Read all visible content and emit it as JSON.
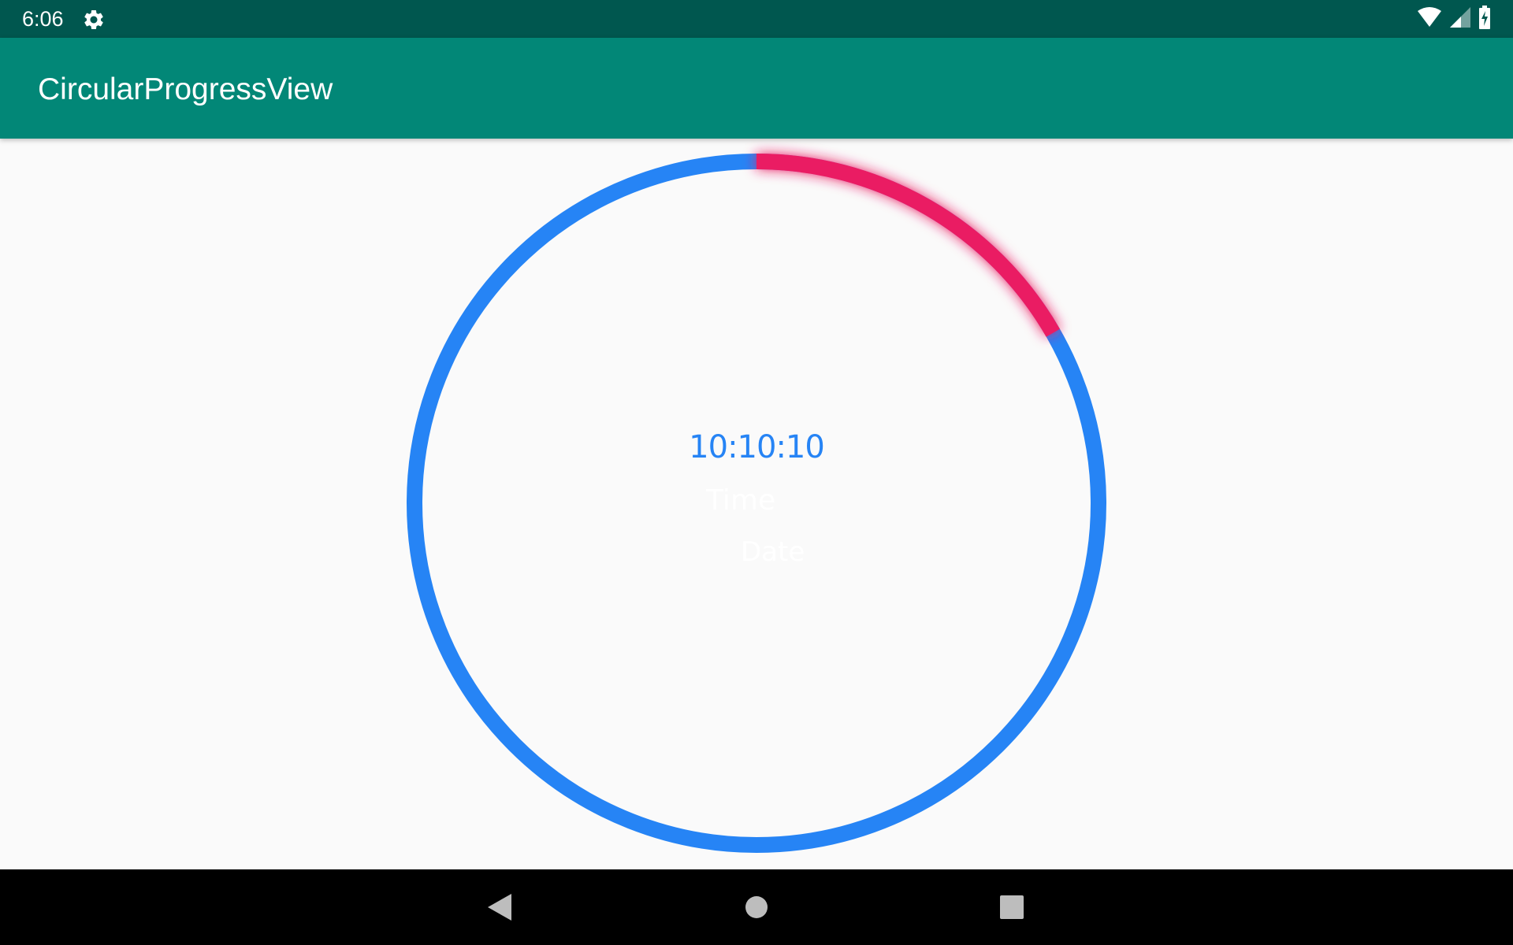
{
  "status_bar": {
    "time": "6:06",
    "icons": [
      "settings-icon",
      "wifi-icon",
      "cellular-signal-icon",
      "battery-charging-icon"
    ]
  },
  "app_bar": {
    "title": "CircularProgressView"
  },
  "progress_view": {
    "progress_fraction": 0.167,
    "track_color": "#2684f5",
    "progress_color": "#ea1e63",
    "time_value": "10:10:10",
    "time_label": "Time",
    "date_label": "Date",
    "time_value_color": "#2684f5",
    "label_color": "#ffffff"
  },
  "nav_bar": {
    "buttons": [
      "back-icon",
      "home-icon",
      "recents-icon"
    ]
  }
}
